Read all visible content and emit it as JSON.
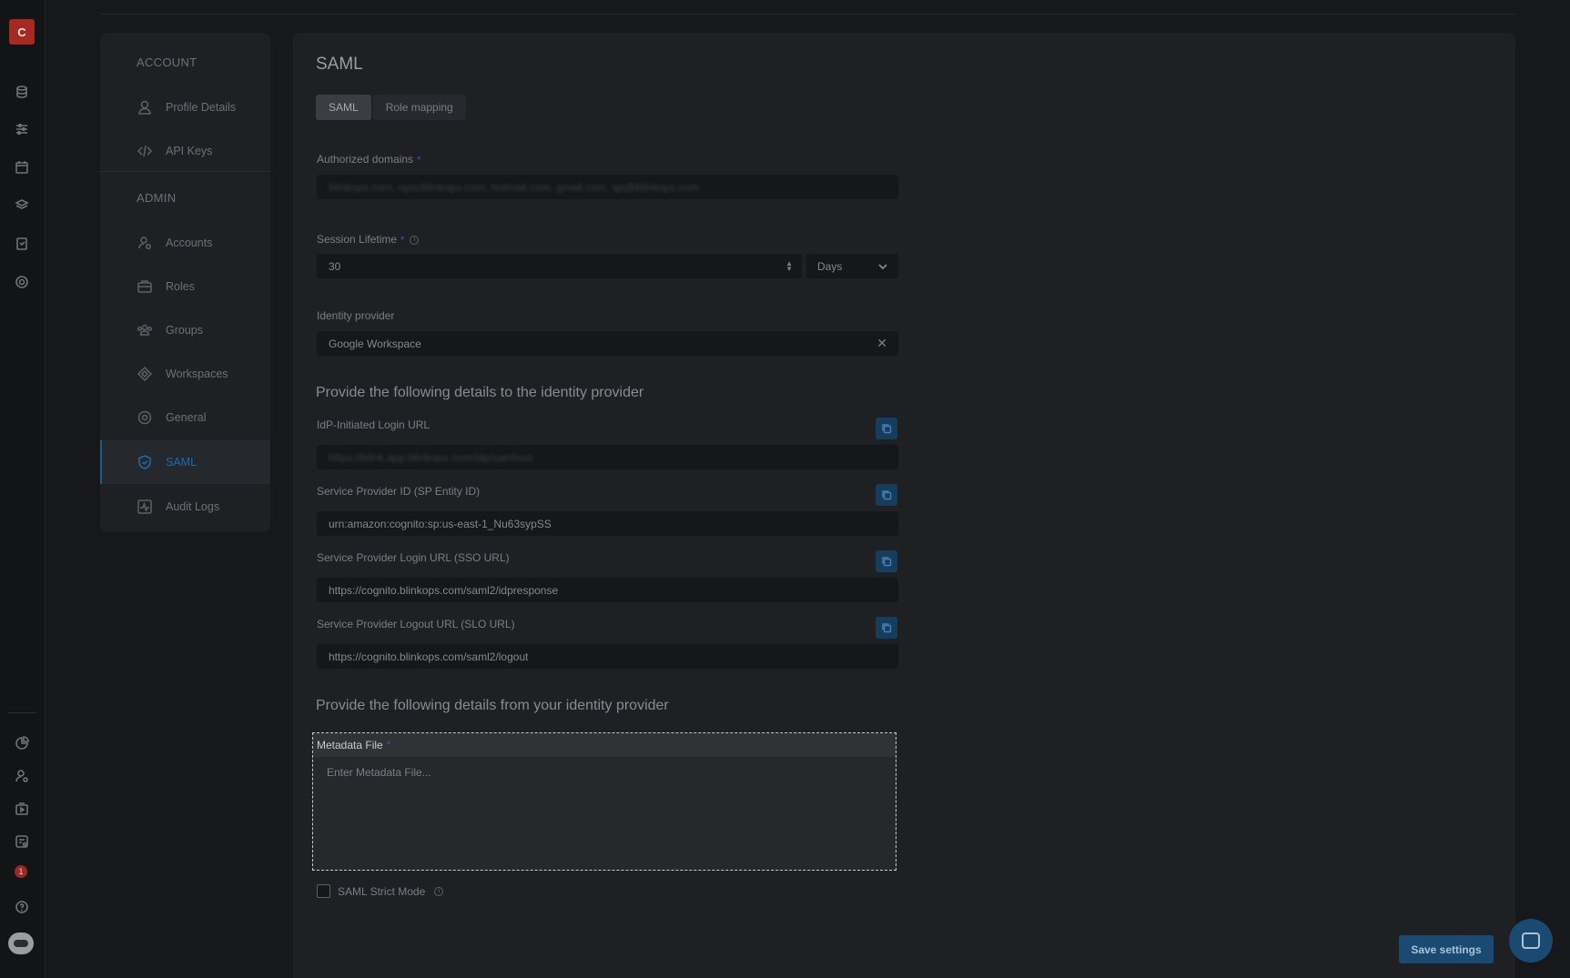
{
  "rail": {
    "avatar_letter": "C",
    "alert_count": "1",
    "top_icons": [
      "database-icon",
      "sliders-icon",
      "calendar-icon",
      "layers-icon",
      "clipboard-icon",
      "target-icon"
    ],
    "bottom_icons": [
      "pie-chart-icon",
      "user-gear-icon",
      "play-folder-icon",
      "list-gear-icon",
      "alert-icon",
      "help-icon",
      "bot-icon"
    ]
  },
  "nav": {
    "account_section": "ACCOUNT",
    "admin_section": "ADMIN",
    "items": [
      {
        "label": "Profile Details",
        "icon": "user-icon"
      },
      {
        "label": "API Keys",
        "icon": "code-icon"
      },
      {
        "label": "Accounts",
        "icon": "user-gear-icon"
      },
      {
        "label": "Roles",
        "icon": "briefcase-icon"
      },
      {
        "label": "Groups",
        "icon": "users-icon"
      },
      {
        "label": "Workspaces",
        "icon": "diamond-icon"
      },
      {
        "label": "General",
        "icon": "settings-icon"
      },
      {
        "label": "SAML",
        "icon": "shield-check-icon"
      },
      {
        "label": "Audit Logs",
        "icon": "activity-icon"
      }
    ],
    "accent_color": "#1e6bad"
  },
  "main": {
    "title": "SAML",
    "tabs": [
      "SAML",
      "Role mapping"
    ],
    "authorized_domains": {
      "label": "Authorized domains",
      "value": "blinkops.com, opscblinkops.com, hotmail.com, gmail.com, qa@blinkops.com"
    },
    "session_lifetime": {
      "label": "Session Lifetime",
      "value": "30",
      "unit": "Days"
    },
    "identity_provider": {
      "label": "Identity provider",
      "value": "Google Workspace"
    },
    "to_idp_heading": "Provide the following details to the identity provider",
    "idp_login_url": {
      "label": "IdP-Initiated Login URL",
      "value": "https://blink.app.blinkops.com/idp/samlsso"
    },
    "sp_entity_id": {
      "label": "Service Provider ID (SP Entity ID)",
      "value": "urn:amazon:cognito:sp:us-east-1_Nu63sypSS"
    },
    "sso_url": {
      "label": "Service Provider Login URL (SSO URL)",
      "value": "https://cognito.blinkops.com/saml2/idpresponse"
    },
    "slo_url": {
      "label": "Service Provider Logout URL (SLO URL)",
      "value": "https://cognito.blinkops.com/saml2/logout"
    },
    "from_idp_heading": "Provide the following details from your identity provider",
    "metadata_file": {
      "label": "Metadata File",
      "placeholder": "Enter Metadata File..."
    },
    "strict_mode_label": "SAML Strict Mode",
    "save_label": "Save settings",
    "required_marker": "*",
    "info_marker": "i"
  }
}
